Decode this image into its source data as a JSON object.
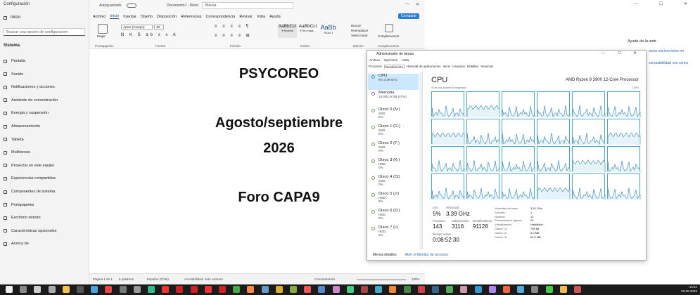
{
  "settings": {
    "title": "Configuración",
    "home": "Inicio",
    "search_placeholder": "Buscar una opción de configuración",
    "section": "Sistema",
    "items": [
      "Pantalla",
      "Sonido",
      "Notificaciones y acciones",
      "Asistente de concentración",
      "Energía y suspensión",
      "Almacenamiento",
      "Tableta",
      "Multitareas",
      "Proyectar en este equipo",
      "Experiencias compartidas",
      "Componentes de sistema",
      "Portapapeles",
      "Escritorio remoto",
      "Características opcionales",
      "Acerca de"
    ]
  },
  "word": {
    "autosave": "Autoguardado",
    "docname": "Documento1 - Word",
    "search": "Buscar",
    "menu": [
      "Archivo",
      "Inicio",
      "Insertar",
      "Diseño",
      "Disposición",
      "Referencias",
      "Correspondencia",
      "Revisar",
      "Vista",
      "Ayuda"
    ],
    "share": "Compartir",
    "paste": "Pegar",
    "font": "Aptos (Cuerpo)",
    "size": "48",
    "styles": [
      {
        "sample": "AaBbCcI",
        "name": "¶ Normal"
      },
      {
        "sample": "AaBbCcI",
        "name": "¶ Sin espa..."
      },
      {
        "sample": "AaBb",
        "name": "Título 1"
      }
    ],
    "edit": [
      "Buscar",
      "Reemplazar",
      "Seleccionar"
    ],
    "complements": "Complementos",
    "groups": [
      "Portapapeles",
      "Fuente",
      "Párrafo",
      "Estilos",
      "Edición",
      "Complementos"
    ],
    "doc_lines": [
      "PSYCOREO",
      "Agosto/septiembre",
      "2026",
      "Foro CAPA9"
    ],
    "status": {
      "page": "Página 1 de 1",
      "words": "5 palabras",
      "lang": "Español (Chile)",
      "access": "Accesibilidad: todo correcto",
      "focus": "Concentración",
      "zoom": "100%"
    }
  },
  "background": {
    "web_title": "Ayuda de la web",
    "web_link1": "antos núcleos tiene mi",
    "web_link2": "compatibilidad con varios"
  },
  "taskmgr": {
    "title": "Administrador de tareas",
    "menu": [
      "Archivo",
      "Opciones",
      "Vista"
    ],
    "tabs": [
      "Procesos",
      "Rendimiento",
      "Historial de aplicaciones",
      "Inicio",
      "Usuarios",
      "Detalles",
      "Servicios"
    ],
    "side": [
      {
        "name": "CPU",
        "l1": "5%  3,39 GHz"
      },
      {
        "name": "Memoria",
        "l1": "14,0/31,9 GB (47%)"
      },
      {
        "name": "Disco 0 (N:)",
        "l1": "SSD",
        "l2": "0%"
      },
      {
        "name": "Disco 1 (G:)",
        "l1": "SSD",
        "l2": "0%"
      },
      {
        "name": "Disco 2 (F:)",
        "l1": "SSD",
        "l2": "0%"
      },
      {
        "name": "Disco 3 (K:)",
        "l1": "HDD",
        "l2": "0%"
      },
      {
        "name": "Disco 4 (Ct)",
        "l1": "SSD",
        "l2": "0%"
      },
      {
        "name": "Disco 5 (J:)",
        "l1": "HDD",
        "l2": "0%"
      },
      {
        "name": "Disco 6 (D:)",
        "l1": "HDD",
        "l2": "0%"
      },
      {
        "name": "Disco 7 (I:)",
        "l1": "HDD",
        "l2": "0%"
      }
    ],
    "cpu": "CPU",
    "model": "AMD Ryzen 9 3900 12-Core Processor",
    "util_label": "% de uso durante 60 segundos",
    "max": "100%",
    "stats": {
      "uso": "Uso",
      "uso_v": "5%",
      "vel": "Velocidad",
      "vel_v": "3.39 GHz",
      "proc": "Procesos",
      "proc_v": "143",
      "sub": "Subprocesos",
      "sub_v": "3116",
      "ident": "Identificadores",
      "ident_v": "91128",
      "time": "Tiempo activo",
      "time_v": "0:08:52:30"
    },
    "kv": [
      [
        "Velocidad de base:",
        "3.10 GHz"
      ],
      [
        "Sockets:",
        "1"
      ],
      [
        "Núcleos:",
        "12"
      ],
      [
        "Procesadores lógicos:",
        "24"
      ],
      [
        "Virtualización:",
        "Habilitado"
      ],
      [
        "Caché L1:",
        "768 kB"
      ],
      [
        "Caché L2:",
        "6.0 MB"
      ],
      [
        "Caché L3:",
        "64.0 MB"
      ]
    ],
    "foot_less": "Menos detalles",
    "foot_link": "Abrir el Monitor de recursos"
  },
  "taskbar": {
    "time": "15:54",
    "date": "28-08-2026"
  }
}
